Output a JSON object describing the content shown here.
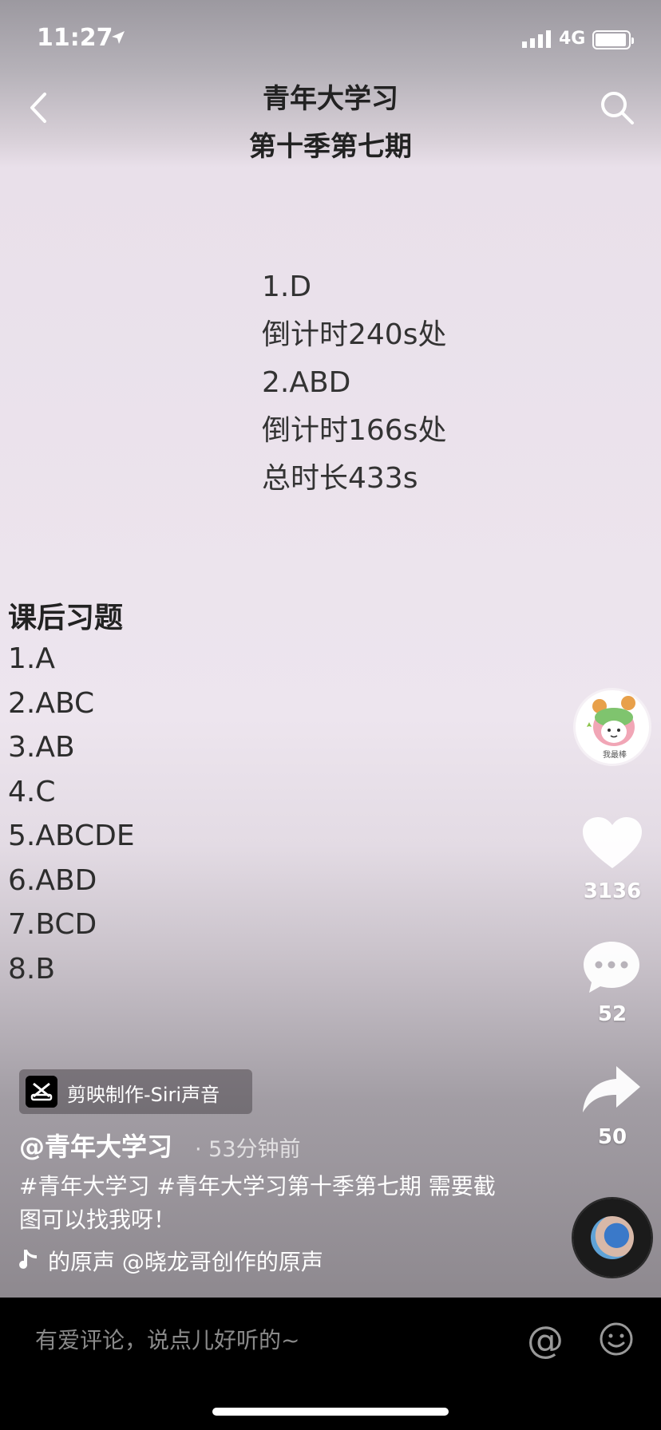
{
  "status_bar": {
    "time": "11:27",
    "network": "4G"
  },
  "header": {
    "title_line1": "青年大学习",
    "title_line2": "第十季第七期"
  },
  "answers": [
    "1.D",
    "倒计时240s处",
    "2.ABD",
    "倒计时166s处",
    "总时长433s"
  ],
  "homework": {
    "title": "课后习题",
    "items": [
      "1.A",
      "2.ABC",
      "3.AB",
      "4.C",
      "5.ABCDE",
      "6.ABD",
      "7.BCD",
      "8.B"
    ]
  },
  "rail": {
    "avatar_caption": "我最棒",
    "like_count": "3136",
    "comment_count": "52",
    "share_count": "50"
  },
  "info": {
    "capcut_label": "剪映制作-Siri声音",
    "author": "@青年大学习",
    "time_ago": "· 53分钟前",
    "description": "#青年大学习 #青年大学习第十季第七期 需要截图可以找我呀！",
    "music": "的原声    @晓龙哥创作的原声"
  },
  "comment_bar": {
    "placeholder": "有爱评论，说点儿好听的~",
    "at_symbol": "@"
  },
  "colors": {
    "background_top": "#9c99a0",
    "background_mid": "#ede5ee",
    "comment_bar": "#000000"
  },
  "icons": [
    "back-icon",
    "search-icon",
    "heart-icon",
    "comment-icon",
    "share-icon",
    "music-note-icon",
    "at-icon",
    "emoji-icon"
  ]
}
